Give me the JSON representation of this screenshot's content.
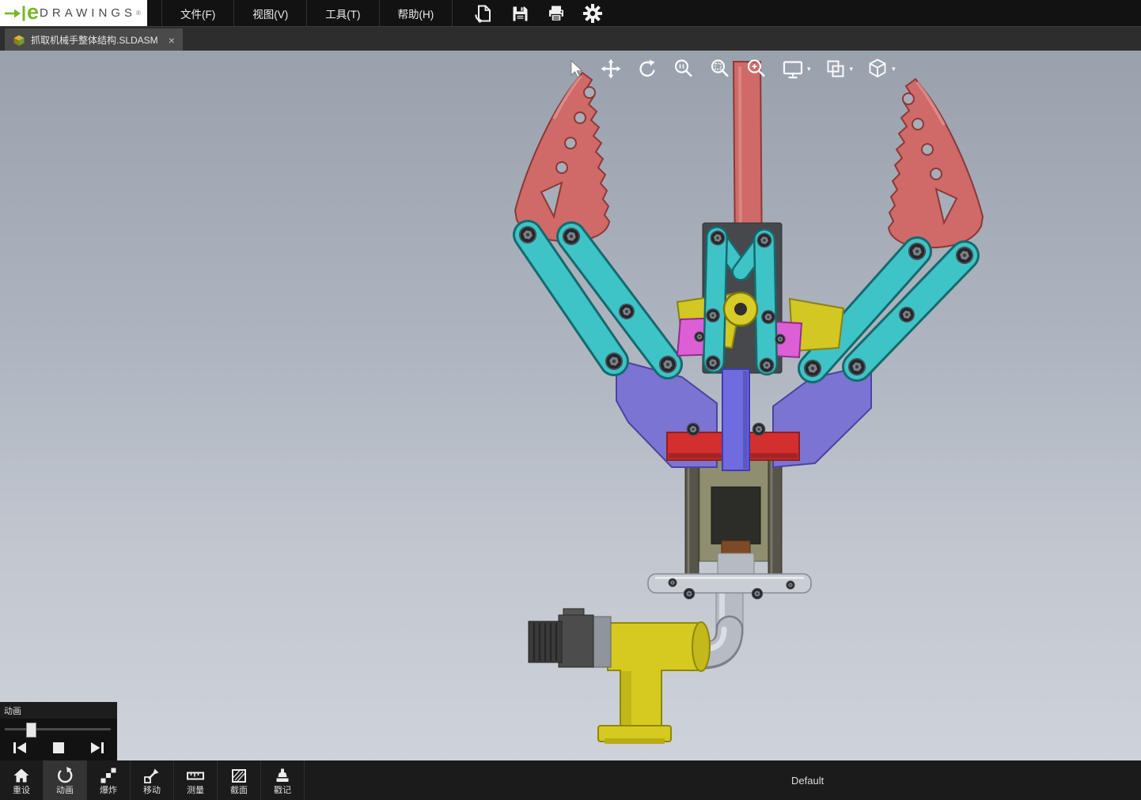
{
  "app": {
    "brand_e": "e",
    "brand_name": "DRAWINGS",
    "brand_reg": "®"
  },
  "menubar": {
    "items": [
      {
        "label": "文件(F)"
      },
      {
        "label": "视图(V)"
      },
      {
        "label": "工具(T)"
      },
      {
        "label": "帮助(H)"
      }
    ],
    "icons": [
      "open",
      "save",
      "print",
      "settings"
    ]
  },
  "tabbar": {
    "tabs": [
      {
        "label": "抓取机械手整体结构.SLDASM"
      }
    ],
    "close_glyph": "×"
  },
  "viewport_toolbar": {
    "icons": [
      "select",
      "pan",
      "rotate",
      "zoom-fit",
      "zoom-area",
      "zoom",
      "display-style",
      "appearance",
      "view-orientation"
    ],
    "caret_glyph": "▾"
  },
  "animation_panel": {
    "title": "动画"
  },
  "bottom_toolbar": {
    "items": [
      {
        "label": "重设"
      },
      {
        "label": "动画"
      },
      {
        "label": "爆炸"
      },
      {
        "label": "移动"
      },
      {
        "label": "测量"
      },
      {
        "label": "截面"
      },
      {
        "label": "戳记"
      }
    ],
    "configuration": "Default"
  },
  "model_colors": {
    "finger_red": "#cf6a68",
    "link_teal": "#3ec3c6",
    "yoke_purple": "#7b74d2",
    "column_blue": "#6f6ce0",
    "clamp_red": "#d32f2f",
    "wedge_yellow": "#d3c723",
    "plate_pink": "#dd5fd6",
    "bracket_yellow": "#d6ca20"
  }
}
